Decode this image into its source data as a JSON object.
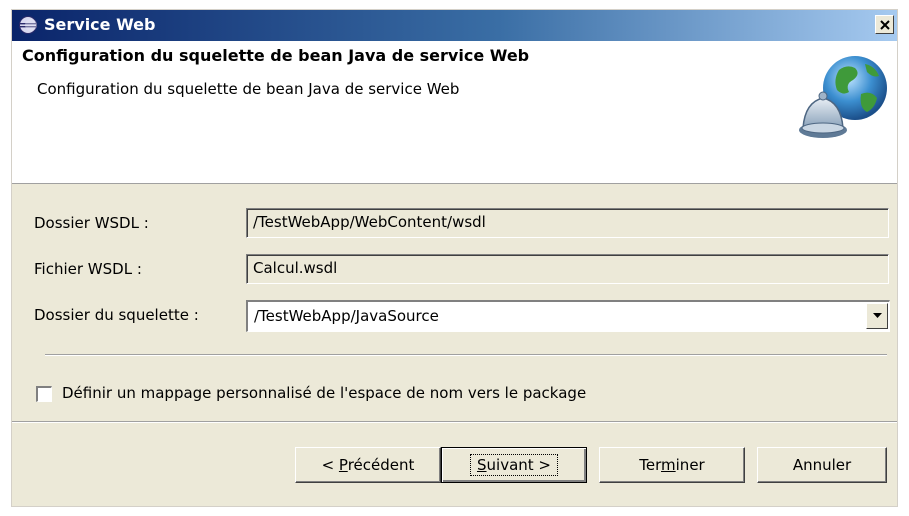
{
  "window": {
    "title": "Service Web"
  },
  "banner": {
    "title": "Configuration du squelette de bean Java de service Web",
    "description": "Configuration du squelette de bean Java de service Web"
  },
  "form": {
    "wsdl_folder_label": "Dossier WSDL :",
    "wsdl_folder_value": "/TestWebApp/WebContent/wsdl",
    "wsdl_file_label": "Fichier WSDL :",
    "wsdl_file_value": "Calcul.wsdl",
    "skeleton_folder_label": "Dossier du squelette :",
    "skeleton_folder_value": "/TestWebApp/JavaSource",
    "custom_mapping_label": "Définir un mappage personnalisé de l'espace de nom vers le package",
    "custom_mapping_checked": false
  },
  "buttons": {
    "back": {
      "pre": "< ",
      "mnemonic": "P",
      "post": "récédent"
    },
    "next": {
      "pre": "",
      "mnemonic": "S",
      "post": "uivant >"
    },
    "finish": {
      "pre": "Ter",
      "mnemonic": "m",
      "post": "iner"
    },
    "cancel": {
      "label": "Annuler"
    }
  },
  "icons": {
    "app": "eclipse-icon",
    "close": "close-icon",
    "banner": "globe-bell-icon",
    "dropdown": "chevron-down-icon"
  },
  "colors": {
    "titlebar_start": "#0a246a",
    "titlebar_end": "#a6caf0",
    "dialog_bg": "#ece9d8",
    "banner_bg": "#ffffff"
  }
}
